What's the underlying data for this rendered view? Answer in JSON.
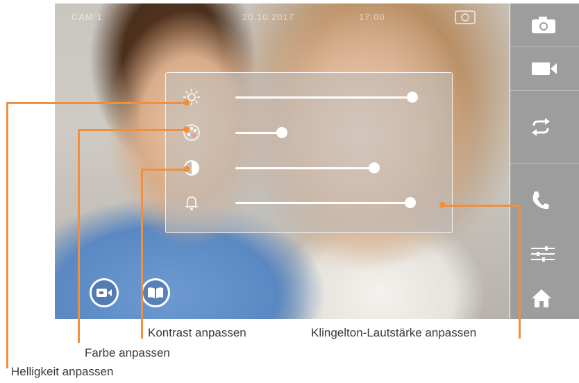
{
  "status_bar": {
    "camera": "CAM 1",
    "date": "20.10.2017",
    "time": "17:00",
    "snapshot_icon": "camera-outline-icon"
  },
  "adjust_panel": {
    "sliders": [
      {
        "icon": "brightness-icon",
        "level": 0.88
      },
      {
        "icon": "color-palette-icon",
        "level": 0.23
      },
      {
        "icon": "contrast-icon",
        "level": 0.69
      },
      {
        "icon": "bell-icon",
        "level": 0.87
      }
    ]
  },
  "sidebar": {
    "buttons": [
      "photo-camera-icon",
      "video-camera-icon",
      "switch-icon",
      "phone-icon",
      "settings-icon",
      "home-icon"
    ]
  },
  "bottom_buttons": [
    "video-playback-icon",
    "book-icon"
  ],
  "callouts": {
    "brightness": "Helligkeit anpassen",
    "color": "Farbe anpassen",
    "contrast": "Kontrast anpassen",
    "volume": "Klingelton-Lautstärke anpassen"
  },
  "colors": {
    "accent": "#f0903e",
    "sidebar": "#9d9d9d",
    "panel": "#bebebe"
  }
}
